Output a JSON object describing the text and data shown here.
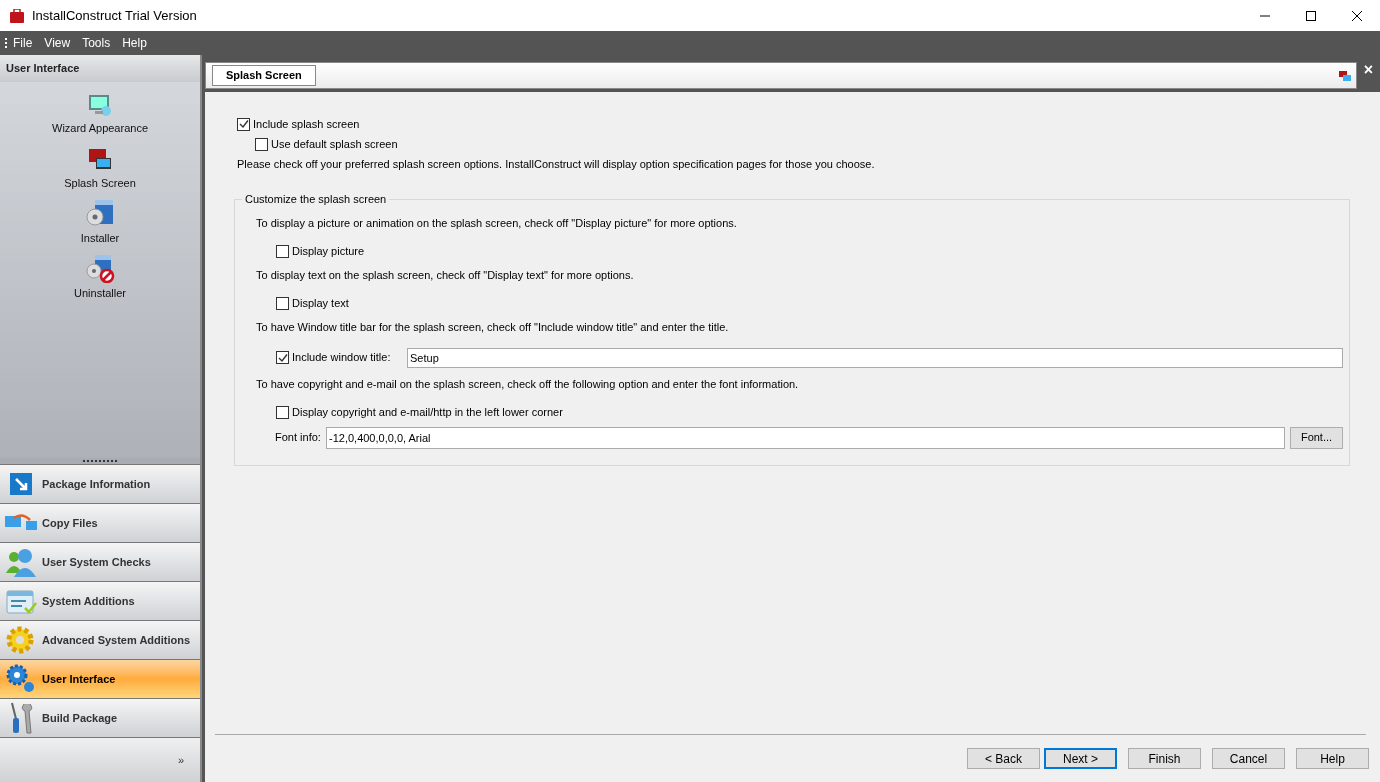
{
  "window": {
    "title": "InstallConstruct Trial Version"
  },
  "menu": [
    "File",
    "View",
    "Tools",
    "Help"
  ],
  "sidebar": {
    "header": "User Interface",
    "items": [
      {
        "label": "Wizard Appearance"
      },
      {
        "label": "Splash Screen"
      },
      {
        "label": "Installer"
      },
      {
        "label": "Uninstaller"
      }
    ],
    "nav": [
      {
        "label": "Package Information",
        "selected": false
      },
      {
        "label": "Copy Files",
        "selected": false
      },
      {
        "label": "User System Checks",
        "selected": false
      },
      {
        "label": "System Additions",
        "selected": false
      },
      {
        "label": "Advanced System Additions",
        "selected": false
      },
      {
        "label": "User Interface",
        "selected": true
      },
      {
        "label": "Build Package",
        "selected": false
      }
    ],
    "more": "»"
  },
  "tab": {
    "label": "Splash Screen",
    "close": "×"
  },
  "options": [
    {
      "label": "Include splash screen",
      "checked": true,
      "indent": false
    },
    {
      "label": "Use default splash screen",
      "checked": false,
      "indent": true
    }
  ],
  "note": "Please check off your preferred splash screen options. InstallConstruct will display option specification pages for those you choose.",
  "group": {
    "title": "Customize the splash screen",
    "items": [
      {
        "kind": "text",
        "text": "To display a picture or animation on the splash screen, check off \"Display picture\" for more options."
      },
      {
        "kind": "checkbox",
        "label": "Display picture",
        "checked": false
      },
      {
        "kind": "text",
        "text": "To display text on the splash screen, check off \"Display text\" for more options."
      },
      {
        "kind": "checkbox",
        "label": "Display text",
        "checked": false
      },
      {
        "kind": "text",
        "text": "To have Window title bar for the splash screen, check off \"Include window title\" and enter the title."
      },
      {
        "kind": "checkfield",
        "label": "Include window title:",
        "checked": true,
        "value": "Setup"
      },
      {
        "kind": "text",
        "text": "To have copyright and e-mail on the splash screen, check off the following option and enter the font information."
      },
      {
        "kind": "checkbox",
        "label": "Display copyright and e-mail/http in the left lower corner",
        "checked": false
      },
      {
        "kind": "field",
        "label": "Font info:",
        "value": "-12,0,400,0,0,0, Arial",
        "button": "Font..."
      }
    ]
  },
  "buttons": [
    {
      "label": "< Back",
      "focused": false
    },
    {
      "label": "Next >",
      "focused": true
    },
    {
      "label": "Finish",
      "focused": false
    },
    {
      "label": "Cancel",
      "focused": false
    },
    {
      "label": "Help",
      "focused": false
    }
  ]
}
